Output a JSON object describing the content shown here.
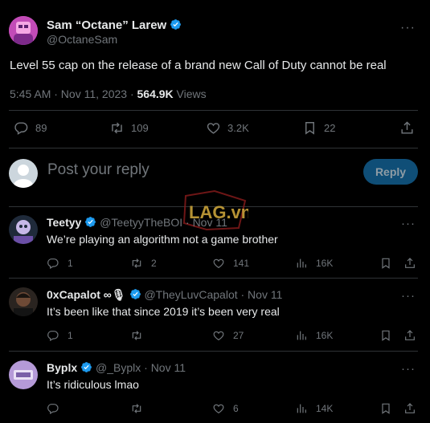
{
  "main_tweet": {
    "author_name": "Sam “Octane” Larew",
    "handle": "@OctaneSam",
    "text": "Level 55 cap on the release of a brand new Call of Duty cannot be real",
    "time": "5:45 AM · Nov 11, 2023 · ",
    "views_count": "564.9K",
    "views_label": " Views",
    "stats": {
      "replies": "89",
      "reposts": "109",
      "likes": "3.2K",
      "bookmarks": "22"
    }
  },
  "composer": {
    "placeholder": "Post your reply",
    "button": "Reply"
  },
  "watermark": {
    "text": "LAG.vn"
  },
  "replies": [
    {
      "name": "Teetyy",
      "handle": "@TeetyyTheBOI · Nov 11",
      "text": "We’re playing an algorithm not a game brother",
      "stats": {
        "replies": "1",
        "reposts": "2",
        "likes": "141",
        "views": "16K"
      }
    },
    {
      "name": "0xCapalot ∞🎙",
      "handle": "@TheyLuvCapalot · Nov 11",
      "text": "It’s been like that since 2019 it’s been very real",
      "stats": {
        "replies": "1",
        "reposts": "",
        "likes": "27",
        "views": "16K"
      }
    },
    {
      "name": "Byplx",
      "handle": "@_Byplx · Nov 11",
      "text": "It’s ridiculous lmao",
      "stats": {
        "replies": "",
        "reposts": "",
        "likes": "6",
        "views": "14K"
      }
    }
  ],
  "colors": {
    "background": "#000000",
    "text": "#e7e9ea",
    "muted": "#71767b",
    "verified": "#1d9bf0",
    "divider": "#2f3336",
    "reply_button": "#0f4e77"
  }
}
